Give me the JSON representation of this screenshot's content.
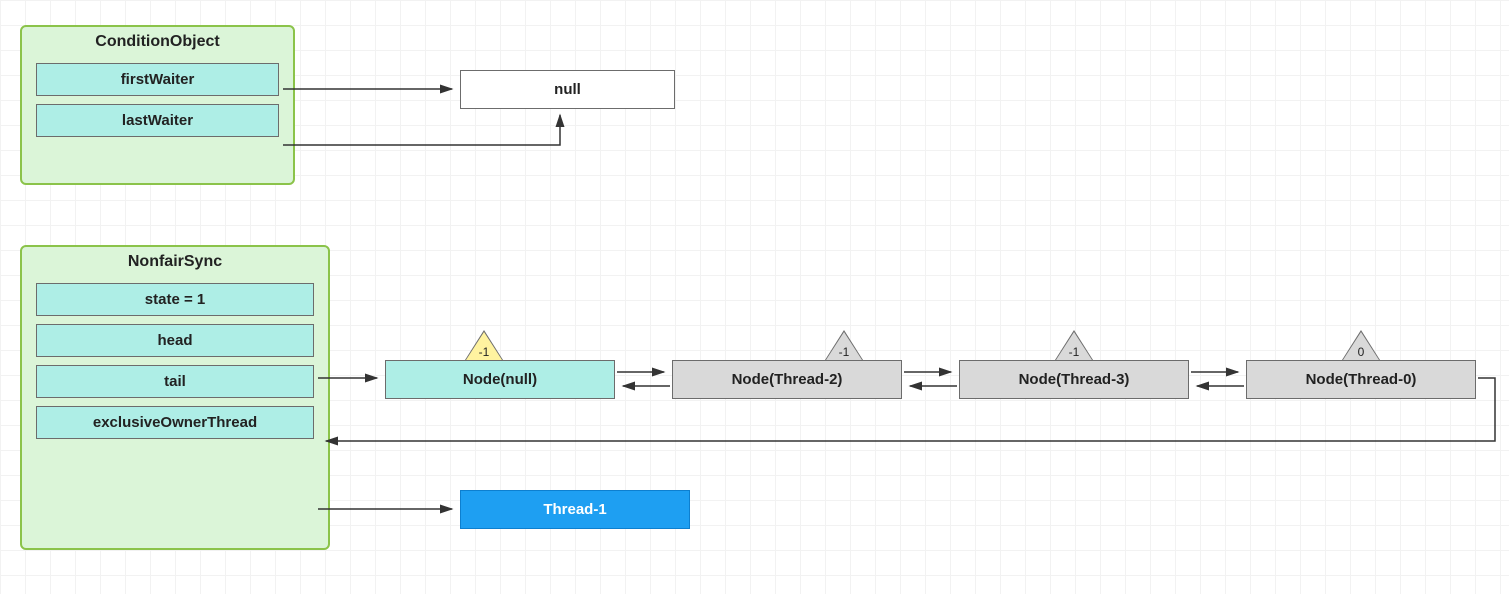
{
  "condition_object": {
    "title": "ConditionObject",
    "fields": {
      "firstWaiter": "firstWaiter",
      "lastWaiter": "lastWaiter"
    }
  },
  "nonfair_sync": {
    "title": "NonfairSync",
    "fields": {
      "state": "state = 1",
      "head": "head",
      "tail": "tail",
      "exclusiveOwnerThread": "exclusiveOwnerThread"
    }
  },
  "null_node": "null",
  "queue": [
    {
      "label": "Node(null)",
      "waitStatus": "-1",
      "color": "teal",
      "triColor": "yellow"
    },
    {
      "label": "Node(Thread-2)",
      "waitStatus": "-1",
      "color": "gray",
      "triColor": "gray"
    },
    {
      "label": "Node(Thread-3)",
      "waitStatus": "-1",
      "color": "gray",
      "triColor": "gray"
    },
    {
      "label": "Node(Thread-0)",
      "waitStatus": "0",
      "color": "gray",
      "triColor": "gray"
    }
  ],
  "owner_thread": "Thread-1",
  "colors": {
    "groupBorder": "#8bc34a",
    "groupFill": "#dbf5d8",
    "teal": "#aeeee6",
    "gray": "#d9d9d9",
    "blue": "#1e9ff2",
    "triYellow": "#fff3a0"
  }
}
